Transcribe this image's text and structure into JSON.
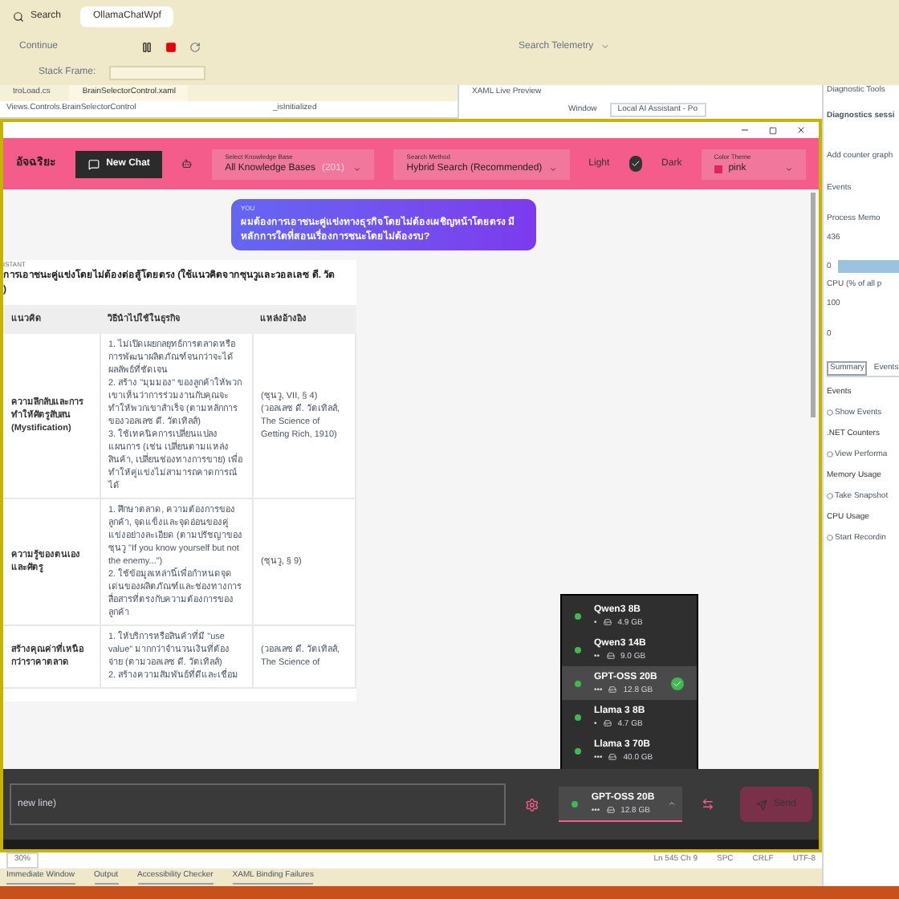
{
  "ide": {
    "menu_search": "Search",
    "solution_tab": "OllamaChatWpf",
    "continue": "Continue",
    "search_telemetry": "Search Telemetry",
    "stack_frame": "Stack Frame:",
    "editor_tabs": [
      {
        "label": "troLoad.cs",
        "selected": false
      },
      {
        "label": "BrainSelectorControl.xaml",
        "selected": true
      }
    ],
    "nav_class": "Views.Controls.BrainSelectorControl",
    "nav_member": "_isInitialized",
    "preview_title": "XAML Live Preview",
    "preview_window_label": "Window",
    "preview_window_value": "Local AI Assistant - Po",
    "status": [
      "Ln 545 Ch 9",
      "SPC",
      "CRLF",
      "UTF-8"
    ],
    "zoom": "30%",
    "bottom_tabs": [
      "Immediate Window",
      "Output",
      "Accessibility Checker",
      "XAML Binding Failures"
    ]
  },
  "diagnostics": {
    "title": "Diagnostic Tools",
    "session": "Diagnostics sessi",
    "add_counter": "Add counter graph",
    "events": "Events",
    "memory": "Process Memo",
    "memory_max": "436",
    "memory_min": "0",
    "cpu": "CPU (% of all p",
    "cpu_max": "100",
    "cpu_min": "0",
    "tabs": [
      {
        "label": "Summary",
        "selected": true
      },
      {
        "label": "Events",
        "selected": false
      }
    ],
    "sections": [
      {
        "title": "Events",
        "action": "Show Events"
      },
      {
        "title": ".NET Counters",
        "action": "View Performa"
      },
      {
        "title": "Memory Usage",
        "action": "Take Snapshot"
      },
      {
        "title": "CPU Usage",
        "action": "Start Recordin"
      }
    ]
  },
  "app": {
    "title": "อัจฉริยะ",
    "new_chat": "New Chat",
    "knowledge_base": {
      "label": "Select Knowledge Base",
      "value": "All Knowledge Bases",
      "count": "(201)"
    },
    "search_method": {
      "label": "Search Method",
      "value": "Hybrid Search (Recommended)"
    },
    "theme": {
      "light": "Light",
      "dark": "Dark",
      "dark_on": true
    },
    "color_theme": {
      "label": "Color Theme",
      "value": "pink",
      "color": "#e0245e"
    },
    "user_message": {
      "sender": "YOU",
      "text": "ผมต้องการเอาชนะคู่แข่งทางธุรกิจโดยไม่ต้องเผชิญหน้าโดยตรง มีหลักการใดที่สอนเรื่องการชนะโดยไม่ต้องรบ?"
    },
    "assistant": {
      "sender": "ISTANT",
      "heading": "การเอาชนะคู่แข่งโดยไม่ต้องต่อสู้โดยตรง (ใช้แนวคิดจากซุนวูและวอลเลซ ดี. วัต",
      "heading_end": ")",
      "table": {
        "columns": [
          "แนวคิด",
          "วิธีนำไปใช้ในธุรกิจ",
          "แหล่งอ้างอิง"
        ],
        "rows": [
          [
            "ความลึกลับและการทำให้ศัตรูสับสน (Mystification)",
            "1. ไม่เปิดเผยกลยุทธ์การตลาดหรือการพัฒนาผลิตภัณฑ์จนกว่าจะได้ผลลัพธ์ที่ชัดเจน\n2. สร้าง \"มุมมอง\" ของลูกค้าให้พวกเขาเห็นว่าการร่วมงานกับคุณจะทำให้พวกเขาสำเร็จ (ตามหลักการของวอลเลซ ดี. วัตเทิลส์)\n3. ใช้เทคนิคการเปลี่ยนแปลงแผนการ (เช่น เปลี่ยนตามแหล่งสินค้า, เปลี่ยนช่องทางการขาย) เพื่อทำให้คู่แข่งไม่สามารถคาดการณ์ได้",
            "(ซุนวู, VII, § 4) (วอลเลซ ดี. วัตเทิลส์, The Science of Getting Rich, 1910)"
          ],
          [
            "ความรู้ของตนเองและศัตรู",
            "1. ศึกษาตลาด, ความต้องการของลูกค้า, จุดแข็งและจุดอ่อนของคู่แข่งอย่างละเอียด (ตามปรัชญาของซุนวู \"If you know yourself but not the enemy...\")\n2. ใช้ข้อมูลเหล่านี้เพื่อกำหนดจุดเด่นของผลิตภัณฑ์และช่องทางการสื่อสารที่ตรงกับความต้องการของลูกค้า",
            "(ซุนวู, § 9)"
          ],
          [
            "สร้างคุณค่าที่เหนือกว่าราคาตลาด",
            "1. ให้บริการหรือสินค้าที่มี \"use value\" มากกว่าจำนวนเงินที่ต้องจ่าย (ตามวอลเลซ ดี. วัตเทิลส์)\n2. สร้างความสัมพันธ์ที่ดีและเชื่อม",
            "(วอลเลซ ดี. วัตเทิลส์, The Science of"
          ]
        ]
      }
    },
    "input_placeholder": "new line)",
    "models": [
      {
        "name": "Qwen3 8B",
        "rating": "•",
        "size": "4.9 GB",
        "selected": false
      },
      {
        "name": "Qwen3 14B",
        "rating": "••",
        "size": "9.0 GB",
        "selected": false
      },
      {
        "name": "GPT-OSS 20B",
        "rating": "•••",
        "size": "12.8 GB",
        "selected": true
      },
      {
        "name": "Llama 3 8B",
        "rating": "•",
        "size": "4.7 GB",
        "selected": false
      },
      {
        "name": "Llama 3 70B",
        "rating": "•••",
        "size": "40.0 GB",
        "selected": false
      }
    ],
    "current_model": {
      "name": "GPT-OSS 20B",
      "rating": "•••",
      "size": "12.8 GB"
    },
    "send": "Send"
  }
}
